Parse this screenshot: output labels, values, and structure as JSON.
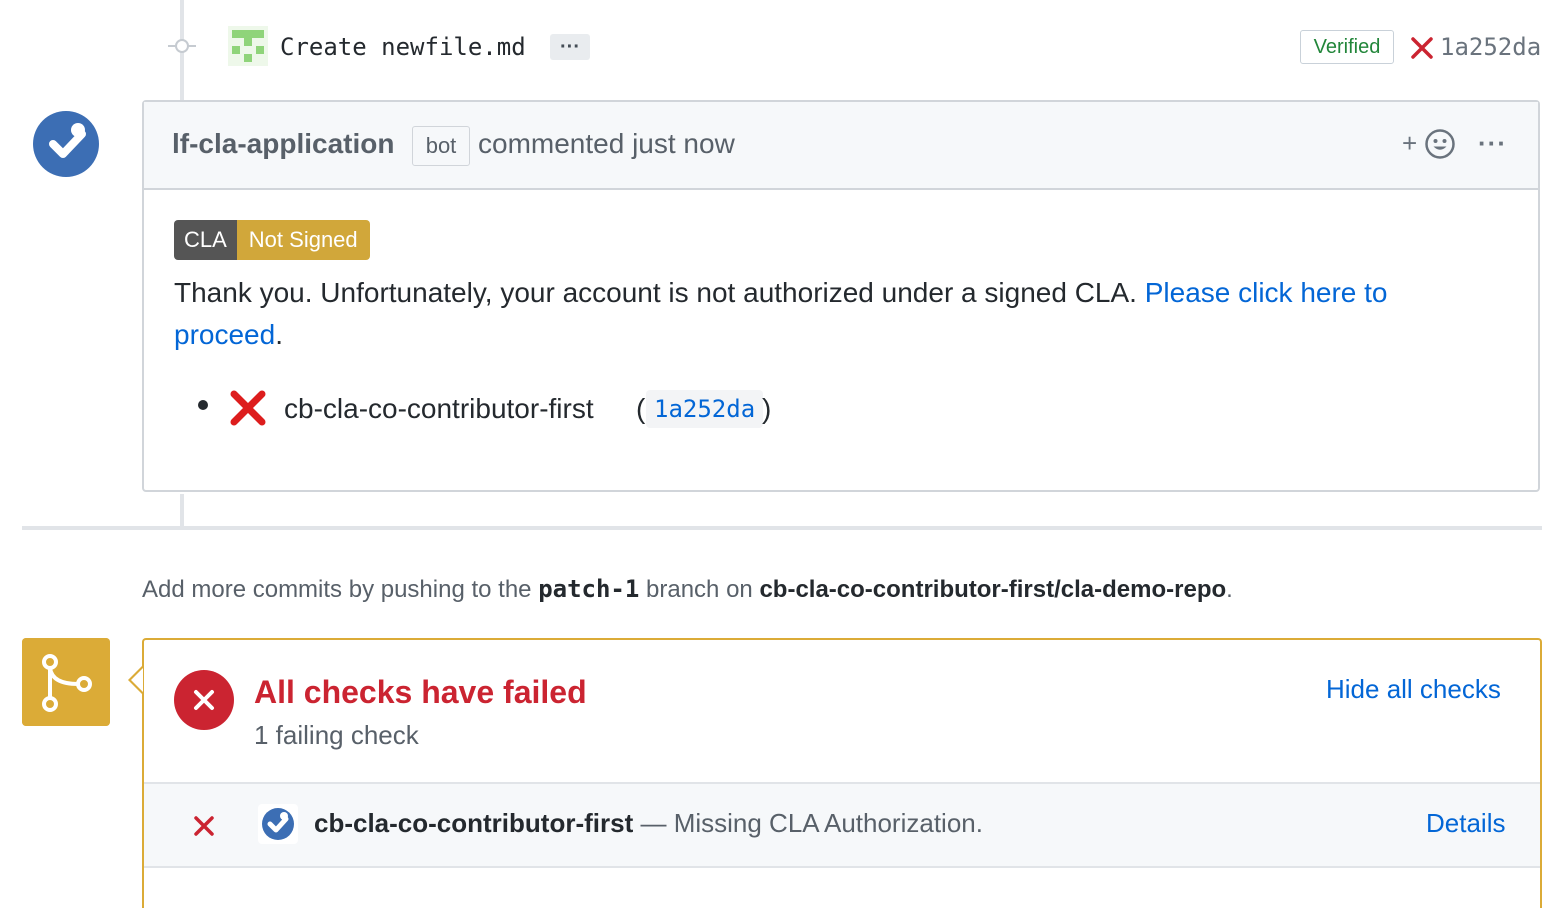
{
  "commit": {
    "message": "Create newfile.md",
    "more_label": "···",
    "verified_label": "Verified",
    "sha": "1a252da"
  },
  "comment": {
    "author": "lf-cla-application",
    "bot_label": "bot",
    "timestamp_text": "commented just now",
    "reaction_label": "+",
    "more_label": "···",
    "badge_left": "CLA",
    "badge_right": "Not Signed",
    "body_text": "Thank you. Unfortunately, your account is not authorized under a signed CLA. ",
    "link_text": "Please click here to proceed",
    "body_end": ".",
    "contributor": {
      "name": "cb-cla-co-contributor-first",
      "paren_open": "(",
      "sha": "1a252da",
      "paren_close": ")"
    }
  },
  "push_hint": {
    "prefix": "Add more commits by pushing to the ",
    "branch": "patch-1",
    "middle": " branch on ",
    "repo": "cb-cla-co-contributor-first/cla-demo-repo",
    "suffix": "."
  },
  "checks": {
    "title": "All checks have failed",
    "subtitle": "1 failing check",
    "toggle_label": "Hide all checks",
    "items": [
      {
        "name": "cb-cla-co-contributor-first",
        "separator": " — ",
        "description": "Missing CLA Authorization.",
        "details_label": "Details"
      }
    ]
  },
  "colors": {
    "fail_red": "#cb2431",
    "link_blue": "#0366d6",
    "pending_yellow": "#dbab37",
    "verified_green": "#22863a",
    "bot_blue": "#3c6eb4"
  },
  "icons": {
    "commit": "git-commit-icon",
    "status_fail": "x-icon",
    "bot_avatar": "check-circle-avatar",
    "reaction": "smiley-icon",
    "merge": "git-merge-icon"
  }
}
